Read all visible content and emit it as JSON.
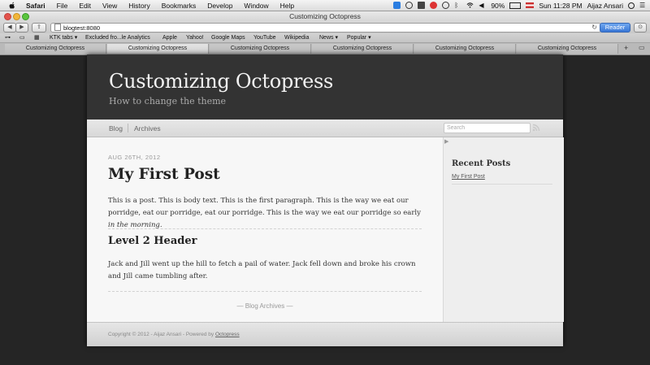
{
  "menubar": {
    "app": "Safari",
    "items": [
      "File",
      "Edit",
      "View",
      "History",
      "Bookmarks",
      "Develop",
      "Window",
      "Help"
    ],
    "battery": "90%",
    "clock": "Sun 11:28 PM",
    "user": "Aijaz Ansari"
  },
  "window": {
    "title": "Customizing Octopress"
  },
  "toolbar": {
    "url": "blogtest:8080",
    "reader_label": "Reader"
  },
  "bookmarks": [
    "KTK tabs ▾",
    "Excluded fro...le Analytics",
    "Apple",
    "Yahoo!",
    "Google Maps",
    "YouTube",
    "Wikipedia",
    "News ▾",
    "Popular ▾"
  ],
  "tabs": [
    "Customizing Octopress",
    "Customizing Octopress",
    "Customizing Octopress",
    "Customizing Octopress",
    "Customizing Octopress",
    "Customizing Octopress"
  ],
  "site": {
    "title": "Customizing Octopress",
    "subtitle": "How to change the theme"
  },
  "nav": {
    "blog": "Blog",
    "archives": "Archives",
    "search_placeholder": "Search"
  },
  "post": {
    "date": "AUG 26TH, 2012",
    "title": "My First Post",
    "para1": "This is a post. This is body text. This is the first paragraph. This is the way we eat our porridge, eat our porridge, eat our porridge. This is the way we eat our porridge so early ",
    "para1_em": "in the morning.",
    "h2": "Level 2 Header",
    "para2": "Jack and Jill went up the hill to fetch a pail of water. Jack fell down and broke his crown and Jill came tumbling after.",
    "archives_link": "— Blog Archives —"
  },
  "sidebar": {
    "title": "Recent Posts",
    "link": "My First Post"
  },
  "footer": {
    "copyright": "Copyright © 2012 - Aijaz Ansari - Powered by ",
    "powered": "Octopress"
  },
  "colors": {
    "header_bg": "#333333",
    "page_bg": "#252525",
    "reader_blue": "#3977d6"
  }
}
